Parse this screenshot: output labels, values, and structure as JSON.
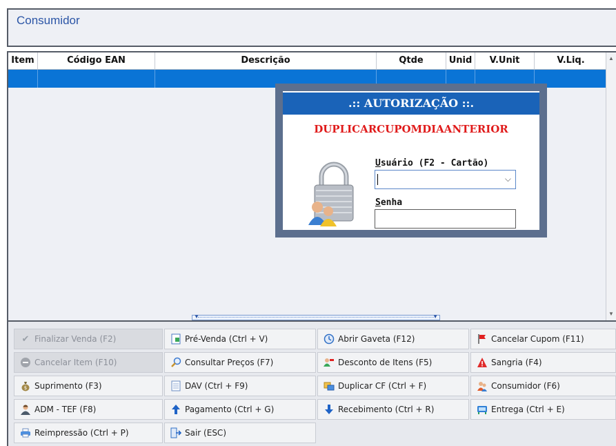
{
  "customer": {
    "label": "Consumidor"
  },
  "grid": {
    "columns": [
      "Item",
      "Código EAN",
      "Descrição",
      "Qtde",
      "Unid",
      "V.Unit",
      "V.Liq."
    ]
  },
  "dialog": {
    "title": ".:: AUTORIZAÇÃO ::.",
    "reason": "DUPLICARCUPOMDIAANTERIOR",
    "user_label": "Usuário (F2 - Cartão)",
    "user_value": "",
    "password_label": "Senha",
    "password_value": ""
  },
  "buttons": [
    {
      "label": "Finalizar Venda (F2)",
      "icon": "check-icon",
      "enabled": false
    },
    {
      "label": "Pré-Venda (Ctrl + V)",
      "icon": "document-icon",
      "enabled": true
    },
    {
      "label": "Abrir Gaveta (F12)",
      "icon": "drawer-icon",
      "enabled": true
    },
    {
      "label": "Cancelar Cupom (F11)",
      "icon": "red-flag-icon",
      "enabled": true
    },
    {
      "label": "Cancelar Item (F10)",
      "icon": "minus-circle-icon",
      "enabled": false
    },
    {
      "label": "Consultar Preços (F7)",
      "icon": "magnifier-icon",
      "enabled": true
    },
    {
      "label": "Desconto de Itens (F5)",
      "icon": "discount-icon",
      "enabled": true
    },
    {
      "label": "Sangria (F4)",
      "icon": "warning-icon",
      "enabled": true
    },
    {
      "label": "Suprimento (F3)",
      "icon": "money-bag-icon",
      "enabled": true
    },
    {
      "label": "DAV (Ctrl + F9)",
      "icon": "page-icon",
      "enabled": true
    },
    {
      "label": "Duplicar CF (Ctrl + F)",
      "icon": "duplicate-icon",
      "enabled": true
    },
    {
      "label": "Consumidor (F6)",
      "icon": "people-icon",
      "enabled": true
    },
    {
      "label": "ADM - TEF (F8)",
      "icon": "admin-user-icon",
      "enabled": true
    },
    {
      "label": "Pagamento (Ctrl + G)",
      "icon": "arrow-up-icon",
      "enabled": true
    },
    {
      "label": "Recebimento (Ctrl + R)",
      "icon": "arrow-down-icon",
      "enabled": true
    },
    {
      "label": "Entrega (Ctrl + E)",
      "icon": "delivery-icon",
      "enabled": true
    },
    {
      "label": "Reimpressão (Ctrl + P)",
      "icon": "printer-icon",
      "enabled": true
    },
    {
      "label": "Sair (ESC)",
      "icon": "exit-icon",
      "enabled": true
    }
  ],
  "colors": {
    "selection": "#0a74d6",
    "dialog_title_bg": "#1a63b8",
    "reason_text": "#e01b1b"
  }
}
